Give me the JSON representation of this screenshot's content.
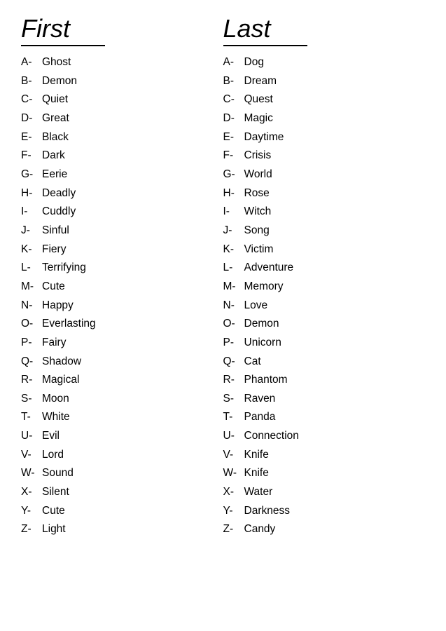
{
  "header": {
    "first_title": "First",
    "last_title": "Last"
  },
  "first_column": [
    {
      "letter": "A-",
      "word": "Ghost"
    },
    {
      "letter": "B-",
      "word": "Demon"
    },
    {
      "letter": "C-",
      "word": "Quiet"
    },
    {
      "letter": "D-",
      "word": "Great"
    },
    {
      "letter": "E-",
      "word": "Black"
    },
    {
      "letter": "F-",
      "word": "Dark"
    },
    {
      "letter": "G-",
      "word": "Eerie"
    },
    {
      "letter": "H-",
      "word": "Deadly"
    },
    {
      "letter": "I-",
      "word": "Cuddly"
    },
    {
      "letter": "J-",
      "word": "Sinful"
    },
    {
      "letter": "K-",
      "word": "Fiery"
    },
    {
      "letter": "L-",
      "word": "Terrifying"
    },
    {
      "letter": "M-",
      "word": "Cute"
    },
    {
      "letter": "N-",
      "word": "Happy"
    },
    {
      "letter": "O-",
      "word": "Everlasting"
    },
    {
      "letter": "P-",
      "word": "Fairy"
    },
    {
      "letter": "Q-",
      "word": "Shadow"
    },
    {
      "letter": "R-",
      "word": "Magical"
    },
    {
      "letter": "S-",
      "word": "Moon"
    },
    {
      "letter": "T-",
      "word": "White"
    },
    {
      "letter": "U-",
      "word": "Evil"
    },
    {
      "letter": "V-",
      "word": "Lord"
    },
    {
      "letter": "W-",
      "word": "Sound"
    },
    {
      "letter": "X-",
      "word": "Silent"
    },
    {
      "letter": "Y-",
      "word": "Cute"
    },
    {
      "letter": "Z-",
      "word": "Light"
    }
  ],
  "last_column": [
    {
      "letter": "A-",
      "word": "Dog"
    },
    {
      "letter": "B-",
      "word": "Dream"
    },
    {
      "letter": "C-",
      "word": "Quest"
    },
    {
      "letter": "D-",
      "word": "Magic"
    },
    {
      "letter": "E-",
      "word": "Daytime"
    },
    {
      "letter": "F-",
      "word": "Crisis"
    },
    {
      "letter": "G-",
      "word": "World"
    },
    {
      "letter": "H-",
      "word": "Rose"
    },
    {
      "letter": "I-",
      "word": "Witch"
    },
    {
      "letter": "J-",
      "word": "Song"
    },
    {
      "letter": "K-",
      "word": "Victim"
    },
    {
      "letter": "L-",
      "word": "Adventure"
    },
    {
      "letter": "M-",
      "word": "Memory"
    },
    {
      "letter": "N-",
      "word": "Love"
    },
    {
      "letter": "O-",
      "word": "Demon"
    },
    {
      "letter": "P-",
      "word": "Unicorn"
    },
    {
      "letter": "Q-",
      "word": "Cat"
    },
    {
      "letter": "R-",
      "word": "Phantom"
    },
    {
      "letter": "S-",
      "word": "Raven"
    },
    {
      "letter": "T-",
      "word": "Panda"
    },
    {
      "letter": "U-",
      "word": "Connection"
    },
    {
      "letter": "V-",
      "word": "Knife"
    },
    {
      "letter": "W-",
      "word": "Knife"
    },
    {
      "letter": "X-",
      "word": "Water"
    },
    {
      "letter": "Y-",
      "word": "Darkness"
    },
    {
      "letter": "Z-",
      "word": "Candy"
    }
  ]
}
